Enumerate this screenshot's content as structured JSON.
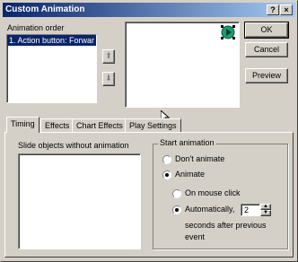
{
  "window": {
    "title": "Custom Animation",
    "help_glyph": "?",
    "close_glyph": "×"
  },
  "animation_order": {
    "label": "Animation order",
    "items": [
      "1. Action button: Forwar"
    ]
  },
  "reorder": {
    "up_glyph": "⬆",
    "down_glyph": "⬇"
  },
  "buttons": {
    "ok": "OK",
    "cancel": "Cancel",
    "preview": "Preview"
  },
  "tabs": [
    "Timing",
    "Effects",
    "Chart Effects",
    "Play Settings"
  ],
  "timing": {
    "no_anim_label": "Slide objects without animation",
    "start_group_label": "Start animation",
    "dont_animate": "Don't animate",
    "animate": "Animate",
    "on_mouse_click": "On mouse click",
    "automatically": "Automatically,",
    "seconds_value": "2",
    "seconds_after_1": "seconds after previous",
    "seconds_after_2": "event"
  },
  "colors": {
    "action_button": "#1f9a6e",
    "selection": "#0a246a"
  },
  "preview_icon": "forward-action-button-icon"
}
